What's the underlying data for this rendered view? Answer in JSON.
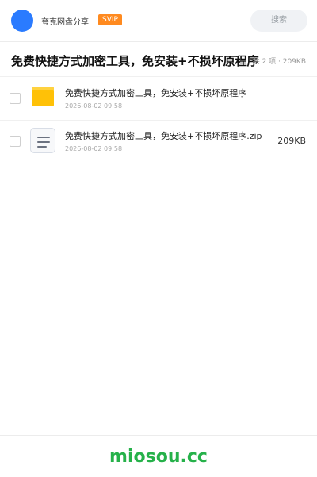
{
  "header": {
    "user_name": "夸克网盘分享",
    "badge": "SVIP",
    "search_label": "搜索"
  },
  "title_bar": {
    "title": "免费快捷方式加密工具，免安装+不损坏原程序",
    "summary": "共 2 项 · 209KB"
  },
  "files": [
    {
      "name": "免费快捷方式加密工具，免安装+不损坏原程序",
      "date": "2026-08-02 09:58",
      "size": "",
      "icon": "folder-icon"
    },
    {
      "name": "免费快捷方式加密工具，免安装+不损坏原程序.zip",
      "date": "2026-08-02 09:58",
      "size": "209KB",
      "icon": "zip-file-icon"
    }
  ],
  "footer": {
    "brand": "miosou.cc"
  },
  "colors": {
    "avatar": "#2a7bff",
    "svip": "#ff8a1f",
    "folder": "#ffc107",
    "brand": "#26b14a"
  }
}
